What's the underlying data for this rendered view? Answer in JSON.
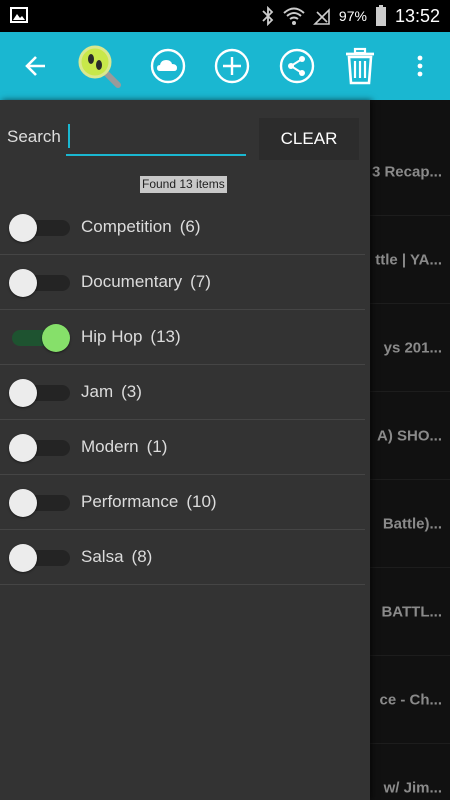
{
  "status_bar": {
    "battery_percent": "97%",
    "time": "13:52",
    "icons": [
      "gallery-icon",
      "bluetooth-icon",
      "wifi-icon",
      "signal-off-icon",
      "battery-icon"
    ]
  },
  "toolbar": {
    "accent_color": "#1ab7d1",
    "buttons": [
      "back-arrow-icon",
      "search-footprints-icon",
      "cloud-icon",
      "add-icon",
      "share-icon",
      "trash-icon",
      "more-vert-icon"
    ]
  },
  "drawer": {
    "search_label": "Search",
    "search_value": "",
    "clear_label": "CLEAR",
    "found_text": "Found 13 items",
    "filters": [
      {
        "label": "Competition",
        "count": "(6)",
        "on": false
      },
      {
        "label": "Documentary",
        "count": "(7)",
        "on": false
      },
      {
        "label": "Hip Hop",
        "count": "(13)",
        "on": true
      },
      {
        "label": "Jam",
        "count": "(3)",
        "on": false
      },
      {
        "label": "Modern",
        "count": "(1)",
        "on": false
      },
      {
        "label": "Performance",
        "count": "(10)",
        "on": false
      },
      {
        "label": "Salsa",
        "count": "(8)",
        "on": false
      }
    ]
  },
  "background_list": {
    "titles": [
      "3 Recap...",
      "ttle | YA...",
      "ys 201...",
      "A) SHO...",
      "Battle)...",
      "BATTL...",
      "ce - Ch...",
      "w/ Jim..."
    ]
  }
}
